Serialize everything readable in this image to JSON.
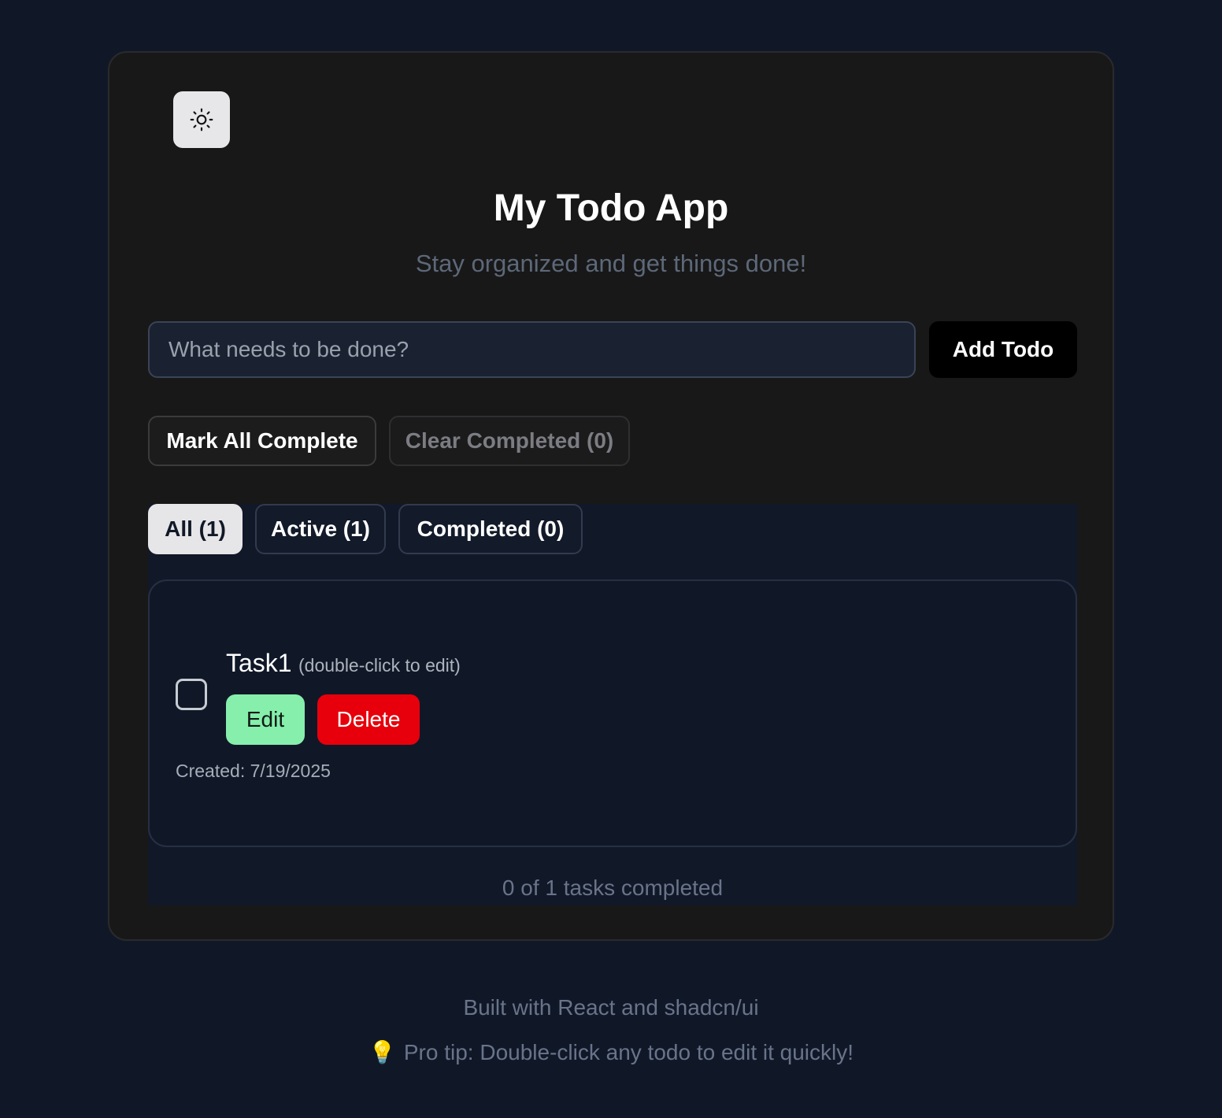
{
  "header": {
    "title": "My Todo App",
    "subtitle": "Stay organized and get things done!",
    "theme_icon": "sun-icon"
  },
  "add_form": {
    "placeholder": "What needs to be done?",
    "value": "",
    "add_label": "Add Todo"
  },
  "bulk_actions": {
    "mark_all_label": "Mark All Complete",
    "clear_completed_label": "Clear Completed (0)"
  },
  "tabs": [
    {
      "label": "All (1)",
      "selected": true
    },
    {
      "label": "Active (1)",
      "selected": false
    },
    {
      "label": "Completed (0)",
      "selected": false
    }
  ],
  "todos": [
    {
      "text": "Task1",
      "hint": "(double-click to edit)",
      "completed": false,
      "edit_label": "Edit",
      "delete_label": "Delete",
      "created": "Created: 7/19/2025"
    }
  ],
  "summary": "0 of 1 tasks completed",
  "footer": {
    "built_with": "Built with React and shadcn/ui",
    "tip_icon": "lightbulb-icon",
    "tip": "Pro tip: Double-click any todo to edit it quickly!"
  },
  "colors": {
    "page_bg": "#101828",
    "card_bg": "#181818",
    "edit_green": "#86efac",
    "delete_red": "#e7000b"
  }
}
